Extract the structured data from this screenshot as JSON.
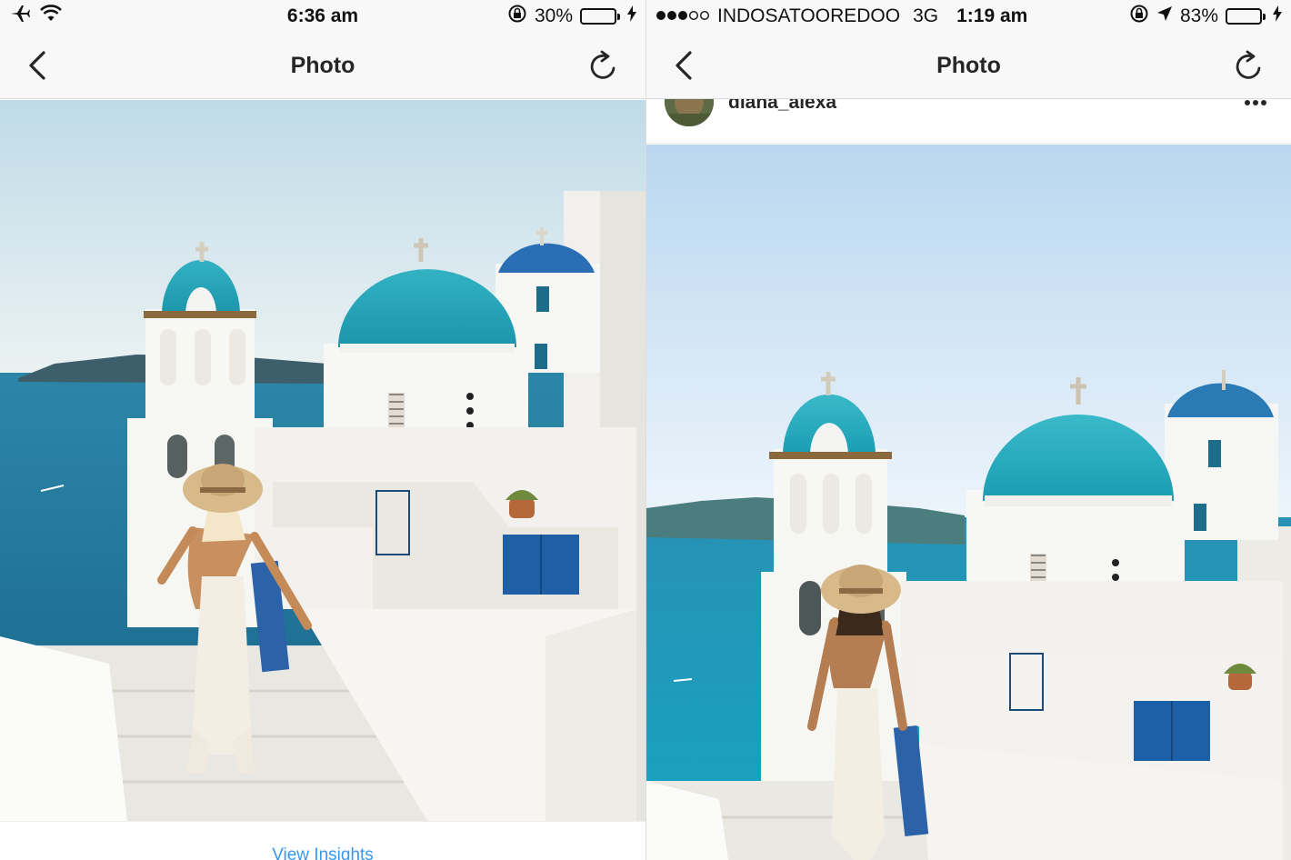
{
  "left": {
    "status": {
      "time": "6:36 am",
      "battery_pct": "30%",
      "battery_level": 0.3
    },
    "nav": {
      "title": "Photo"
    },
    "insights_link": "View Insights"
  },
  "right": {
    "status": {
      "carrier": "INDOSATOOREDOO",
      "network": "3G",
      "time": "1:19 am",
      "battery_pct": "83%",
      "battery_level": 0.83
    },
    "nav": {
      "title": "Photo"
    },
    "post": {
      "username": "diana_alexa"
    }
  },
  "colors": {
    "accent_link": "#3897f0",
    "battery_green": "#4cd964",
    "dome_blue": "#1fa3b8"
  },
  "icons": [
    "airplane-icon",
    "wifi-icon",
    "rotation-lock-icon",
    "charging-icon",
    "location-arrow-icon",
    "back-chevron-icon",
    "refresh-icon",
    "more-options-icon"
  ]
}
